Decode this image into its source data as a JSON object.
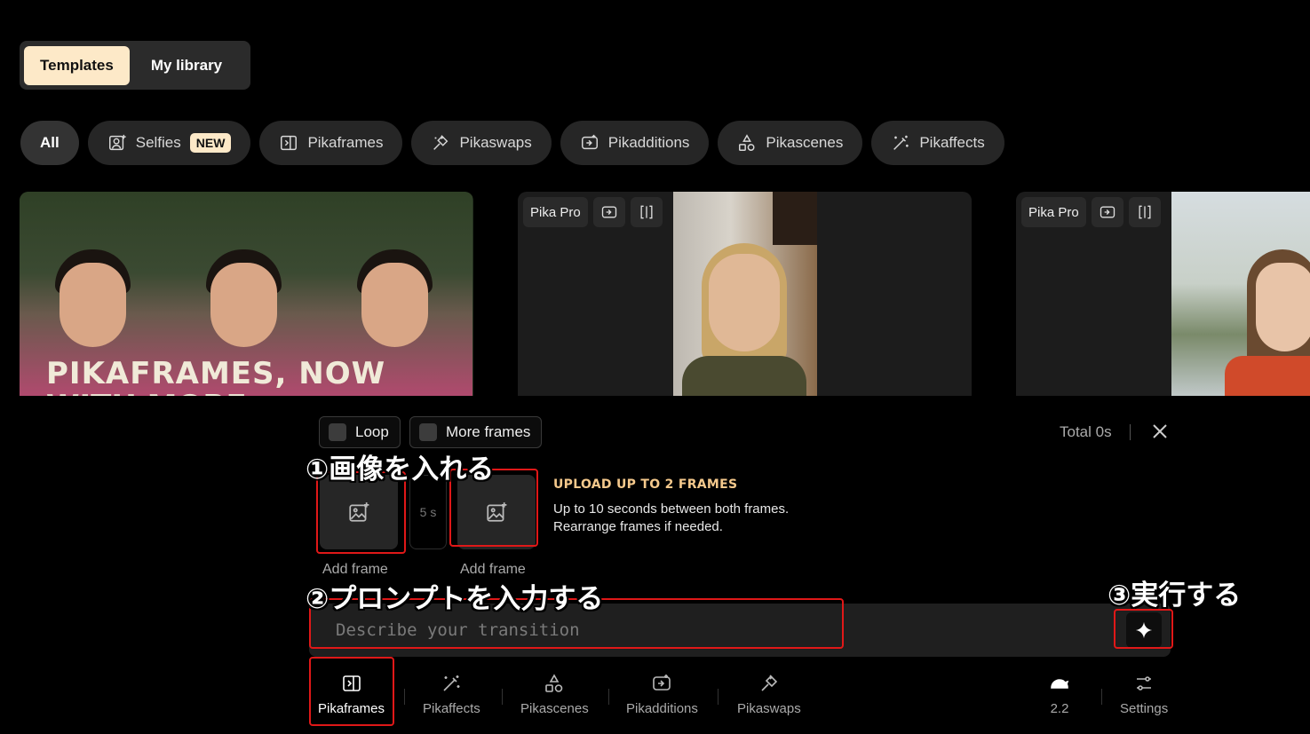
{
  "top_tabs": [
    {
      "label": "Templates",
      "active": true
    },
    {
      "label": "My library",
      "active": false
    }
  ],
  "categories": [
    {
      "label": "All",
      "icon": "none"
    },
    {
      "label": "Selfies",
      "icon": "selfie-icon",
      "badge": "NEW"
    },
    {
      "label": "Pikaframes",
      "icon": "pikaframes-icon"
    },
    {
      "label": "Pikaswaps",
      "icon": "pikaswaps-icon"
    },
    {
      "label": "Pikadditions",
      "icon": "pikadditions-icon"
    },
    {
      "label": "Pikascenes",
      "icon": "pikascenes-icon"
    },
    {
      "label": "Pikaffects",
      "icon": "pikaffects-icon"
    }
  ],
  "cards": [
    {
      "title": "PIKAFRAMES, NOW",
      "title2": "WITH MORE"
    },
    {
      "badge": "Pika Pro"
    },
    {
      "badge": "Pika Pro"
    }
  ],
  "panel": {
    "loop_label": "Loop",
    "more_frames_label": "More frames",
    "total_label": "Total 0s",
    "frame_duration": "5 s",
    "add_frame_label": "Add frame",
    "upload_title": "UPLOAD UP TO 2 FRAMES",
    "upload_line1": "Up to 10 seconds between both frames.",
    "upload_line2": "Rearrange frames if needed.",
    "prompt_placeholder": "Describe your transition",
    "prompt_value": ""
  },
  "toolbar": {
    "tools": [
      "Pikaframes",
      "Pikaffects",
      "Pikascenes",
      "Pikadditions",
      "Pikaswaps"
    ],
    "active_tool": "Pikaframes",
    "model_version": "2.2",
    "settings_label": "Settings"
  },
  "annotations": {
    "step1": "①画像を入れる",
    "step2": "②プロンプトを入力する",
    "step3": "③実行する",
    "color": "#e01818"
  },
  "colors": {
    "accent_cream": "#fde9c8",
    "upload_title": "#f5c98c"
  }
}
